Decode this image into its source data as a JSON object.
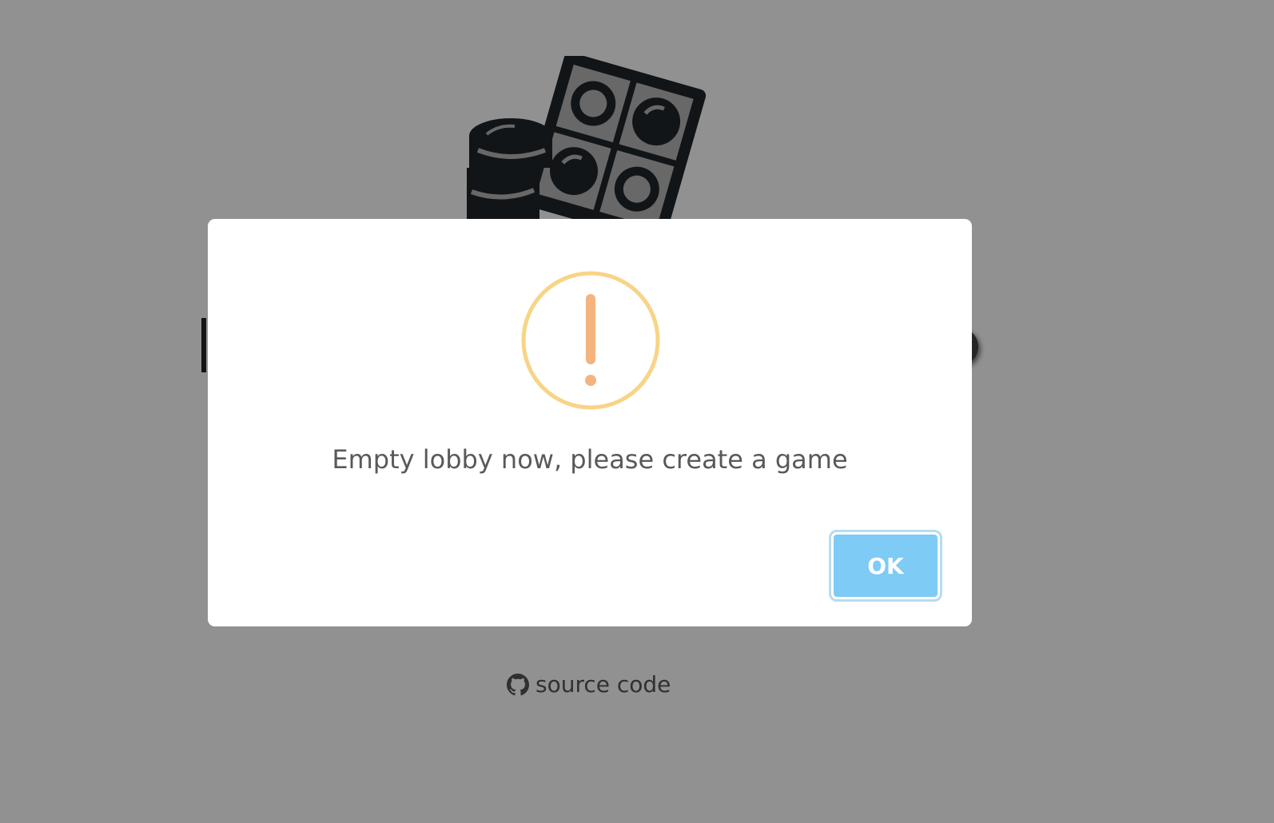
{
  "background": {
    "source_link": {
      "label": "source code",
      "icon": "github-icon"
    },
    "logo": {
      "icon": "board-game-coins-icon"
    }
  },
  "modal": {
    "icon": "warning-exclamation-icon",
    "message": "Empty lobby now, please create a game",
    "ok_label": "OK"
  },
  "colors": {
    "overlay": "#929392",
    "logo": "#212529",
    "warning_ring": "#f8d486",
    "warning_mark": "#f5b37e",
    "ok_button": "#7ecbf5",
    "message_text": "#595959"
  }
}
